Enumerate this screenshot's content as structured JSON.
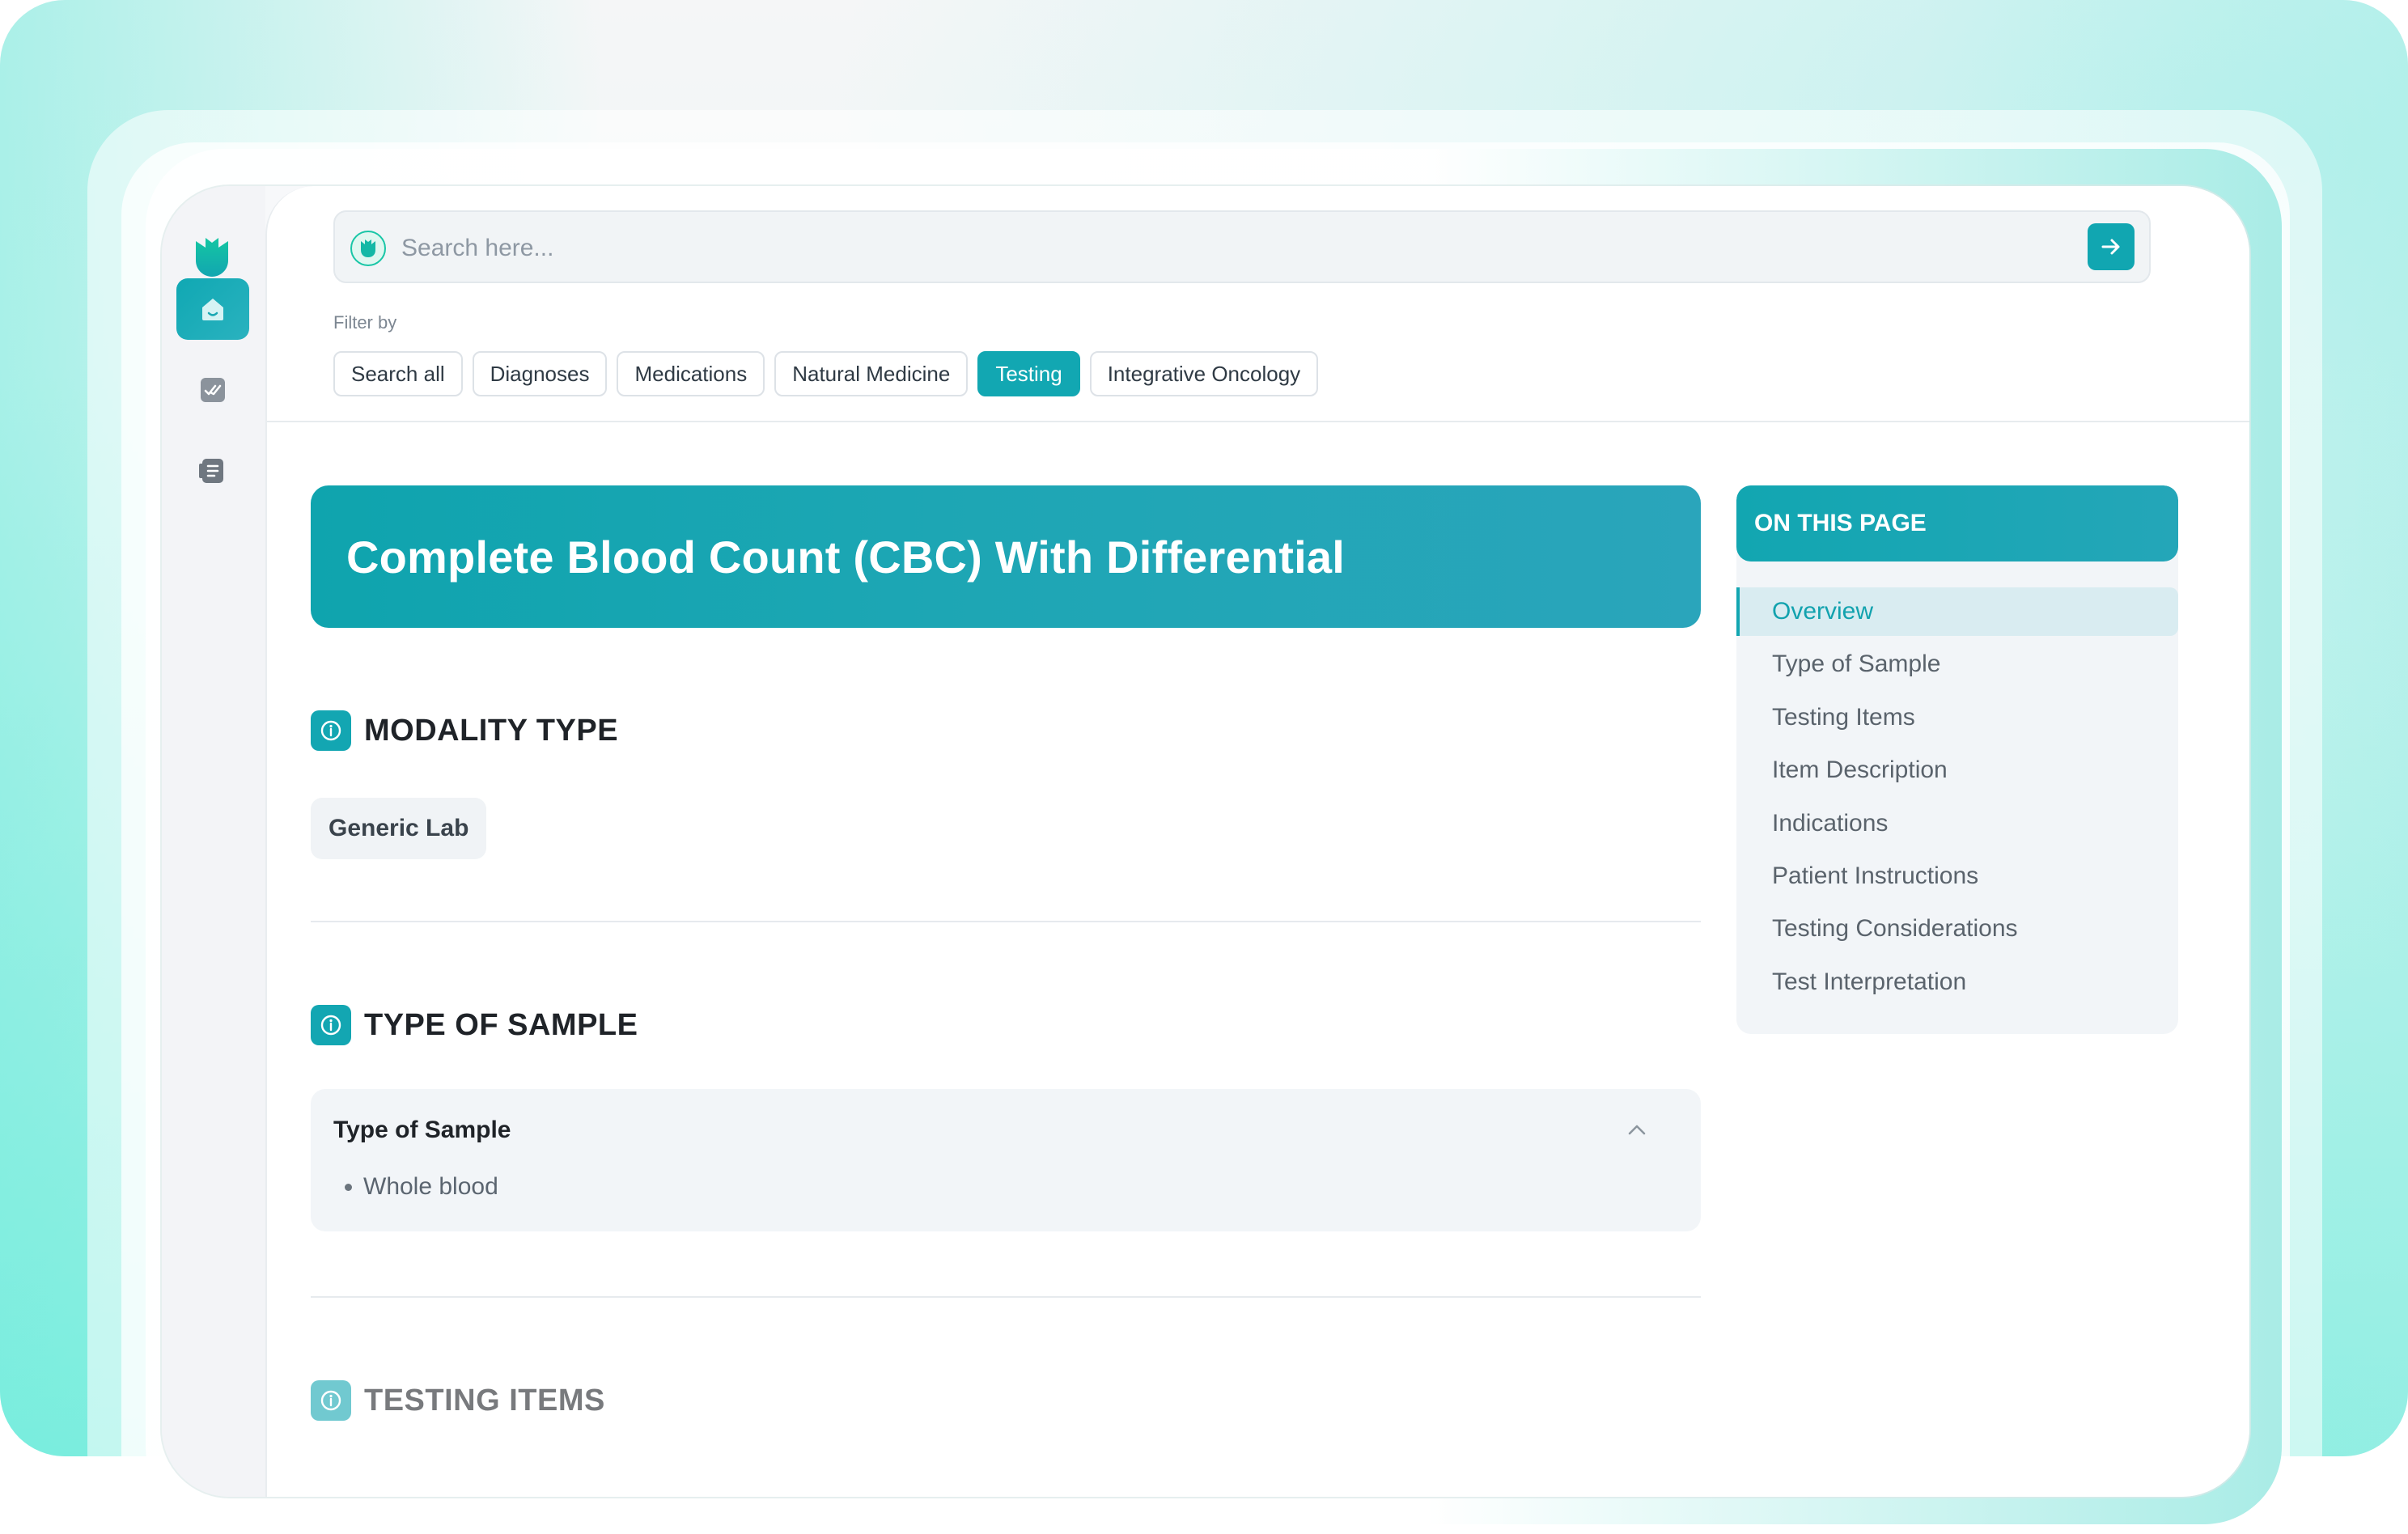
{
  "search": {
    "placeholder": "Search here..."
  },
  "filters": {
    "label": "Filter by",
    "items": [
      "Search all",
      "Diagnoses",
      "Medications",
      "Natural Medicine",
      "Testing",
      "Integrative Oncology"
    ],
    "active": "Testing"
  },
  "page": {
    "title": "Complete Blood Count (CBC) With Differential",
    "sections": {
      "modality": {
        "title": "MODALITY TYPE",
        "tag": "Generic Lab"
      },
      "sample": {
        "title": "TYPE OF SAMPLE",
        "accordion_title": "Type of Sample",
        "items": [
          "Whole blood"
        ]
      },
      "testing_items": {
        "title": "TESTING ITEMS"
      }
    }
  },
  "toc": {
    "heading": "ON THIS PAGE",
    "items": [
      "Overview",
      "Type of Sample",
      "Testing Items",
      "Item Description",
      "Indications",
      "Patient Instructions",
      "Testing Considerations",
      "Test Interpretation"
    ],
    "active": "Overview"
  },
  "colors": {
    "accent": "#12a6b1",
    "brand_logo": "#18c6a6"
  },
  "icons": {
    "rail": [
      "logo-icon",
      "home-icon",
      "checklist-icon",
      "document-icon"
    ],
    "search_submit": "arrow-right-icon",
    "section": "info-icon",
    "accordion": "chevron-up-icon"
  }
}
